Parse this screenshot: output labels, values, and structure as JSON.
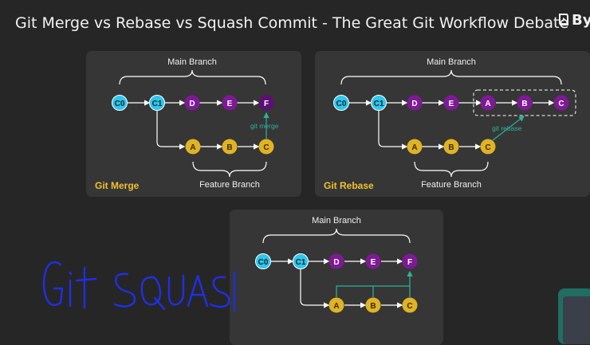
{
  "title": "Git Merge vs Rebase vs Squash Commit - The Great Git Workflow Debate",
  "logo": {
    "text": "By",
    "icon": "logo-icon"
  },
  "colors": {
    "background": "#262626",
    "panel": "#363636",
    "cyan": "#2ec7ec",
    "purple": "#7e1a96",
    "yellow": "#e0b324",
    "arrow": "#2bb39a",
    "caption": "#f2c12e"
  },
  "panels": {
    "merge": {
      "main_label": "Main Branch",
      "feature_label": "Feature Branch",
      "caption": "Git Merge",
      "operation": "git merge",
      "main_commits": [
        "C0",
        "C1",
        "D",
        "E",
        "F"
      ],
      "feature_commits": [
        "A",
        "B",
        "C"
      ]
    },
    "rebase": {
      "main_label": "Main Branch",
      "feature_label": "Feature Branch",
      "caption": "Git Rebase",
      "operation": "git rebase",
      "main_commits": [
        "C0",
        "C1",
        "D",
        "E"
      ],
      "rebased_commits": [
        "A",
        "B",
        "C"
      ],
      "feature_commits": [
        "A",
        "B",
        "C"
      ]
    },
    "squash": {
      "main_label": "Main Branch",
      "main_commits": [
        "C0",
        "C1",
        "D",
        "E",
        "F"
      ],
      "feature_commits": [
        "A",
        "B",
        "C"
      ]
    }
  },
  "annotation": {
    "handwritten": "Git SQUASH"
  }
}
